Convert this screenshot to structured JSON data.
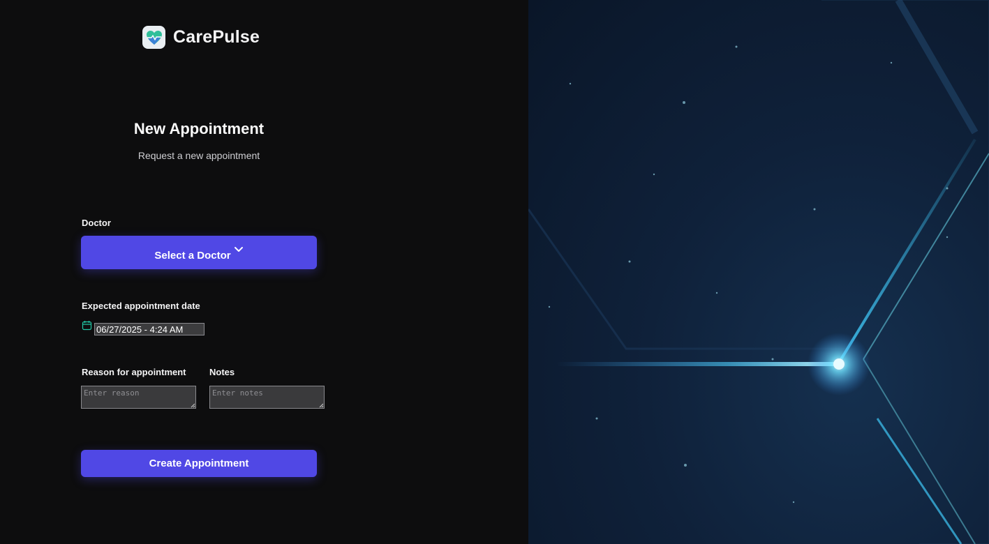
{
  "brand": {
    "name": "CarePulse",
    "logo_icon": "heart-pulse-icon"
  },
  "page": {
    "title": "New Appointment",
    "subtitle": "Request a new appointment"
  },
  "form": {
    "doctor_label": "Doctor",
    "doctor_select": {
      "value": "Select a Doctor",
      "icon": "chevron-down-icon"
    },
    "date_label": "Expected appointment date",
    "date_value": "06/27/2025 - 4:24 AM",
    "date_icon": "calendar-icon",
    "reason_label": "Reason for appointment",
    "reason_placeholder": "Enter reason",
    "notes_label": "Notes",
    "notes_placeholder": "Enter notes",
    "submit_label": "Create Appointment"
  },
  "colors": {
    "accent": "#5048e5",
    "background": "#0d0d0e",
    "panel_background": "#0f213a",
    "glow": "#5fd8f5"
  }
}
